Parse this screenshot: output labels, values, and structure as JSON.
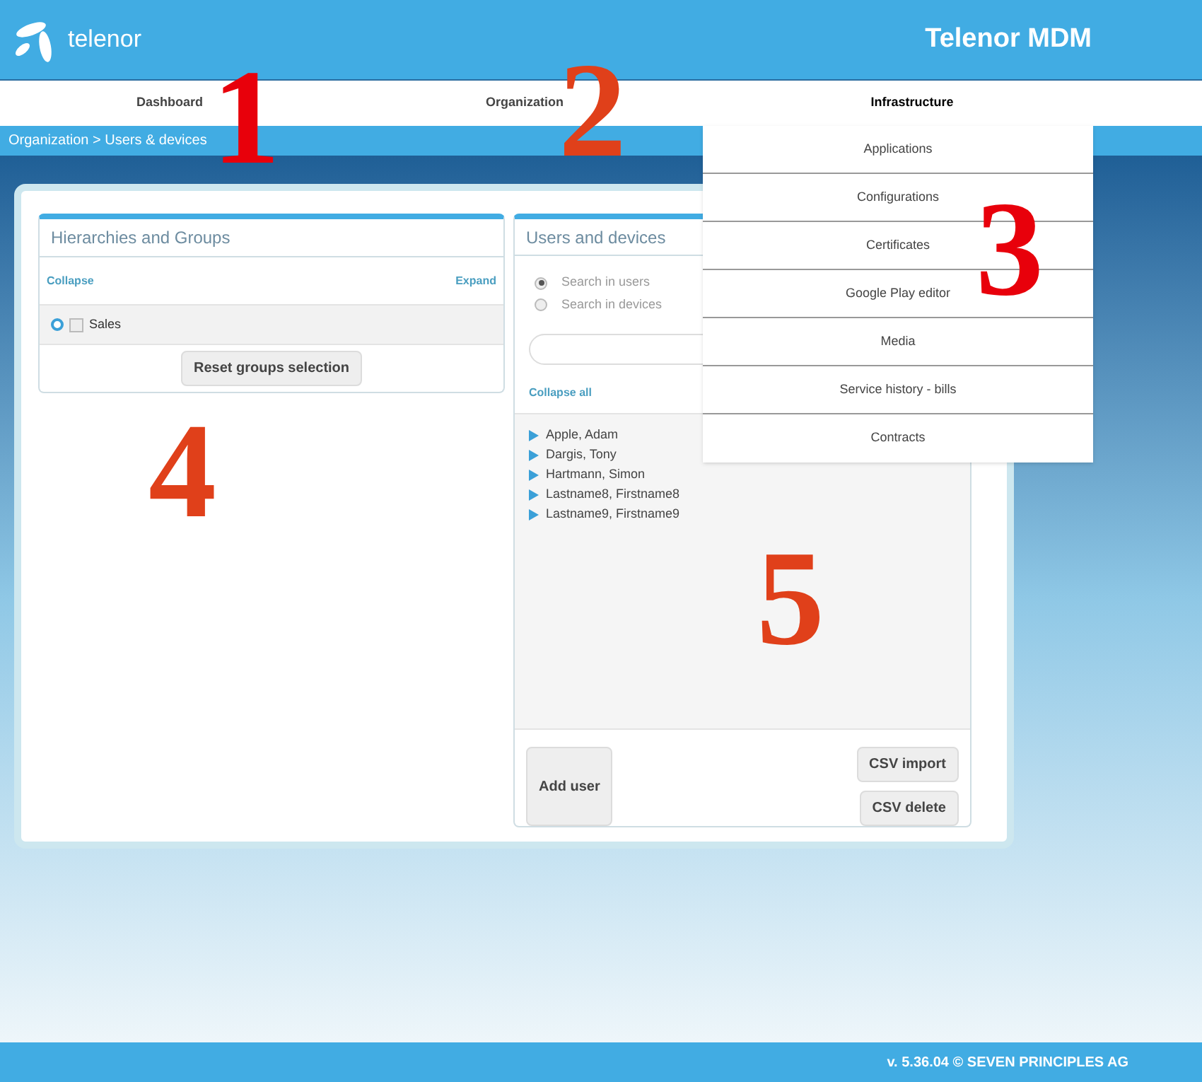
{
  "header": {
    "logo_text": "telenor",
    "title": "Telenor MDM"
  },
  "nav": [
    {
      "label": "Dashboard",
      "selected": false
    },
    {
      "label": "Organization",
      "selected": false
    },
    {
      "label": "Infrastructure",
      "selected": true
    }
  ],
  "breadcrumb": "Organization > Users & devices",
  "dropdown": [
    "Applications",
    "Configurations",
    "Certificates",
    "Google Play editor",
    "Media",
    "Service history - bills",
    "Contracts"
  ],
  "groups_panel": {
    "title": "Hierarchies and Groups",
    "collapse": "Collapse",
    "expand": "Expand",
    "tree": [
      {
        "label": "Sales",
        "checked": false
      }
    ],
    "reset_button": "Reset groups selection"
  },
  "users_panel": {
    "title": "Users and devices",
    "search_options": [
      {
        "label": "Search in users",
        "selected": true
      },
      {
        "label": "Search in devices",
        "selected": false
      }
    ],
    "collapse_all": "Collapse all",
    "users": [
      {
        "name": "Apple, Adam",
        "expanded": false
      },
      {
        "name": "Dargis, Tony",
        "expanded": false
      },
      {
        "name": "Hartmann, Simon",
        "expanded": false
      },
      {
        "name": "Lastname8, Firstname8",
        "expanded": false
      },
      {
        "name": "Lastname9, Firstname9",
        "expanded": false
      }
    ],
    "add_button": "Add user",
    "csv_import": "CSV import",
    "csv_delete": "CSV delete"
  },
  "footer": "v. 5.36.04 © SEVEN PRINCIPLES AG",
  "callouts": [
    {
      "label": "1",
      "color": "#e8000b"
    },
    {
      "label": "2",
      "color": "#e0401a"
    },
    {
      "label": "3",
      "color": "#e8000b"
    },
    {
      "label": "4",
      "color": "#e0401a"
    },
    {
      "label": "5",
      "color": "#e0401a"
    }
  ]
}
